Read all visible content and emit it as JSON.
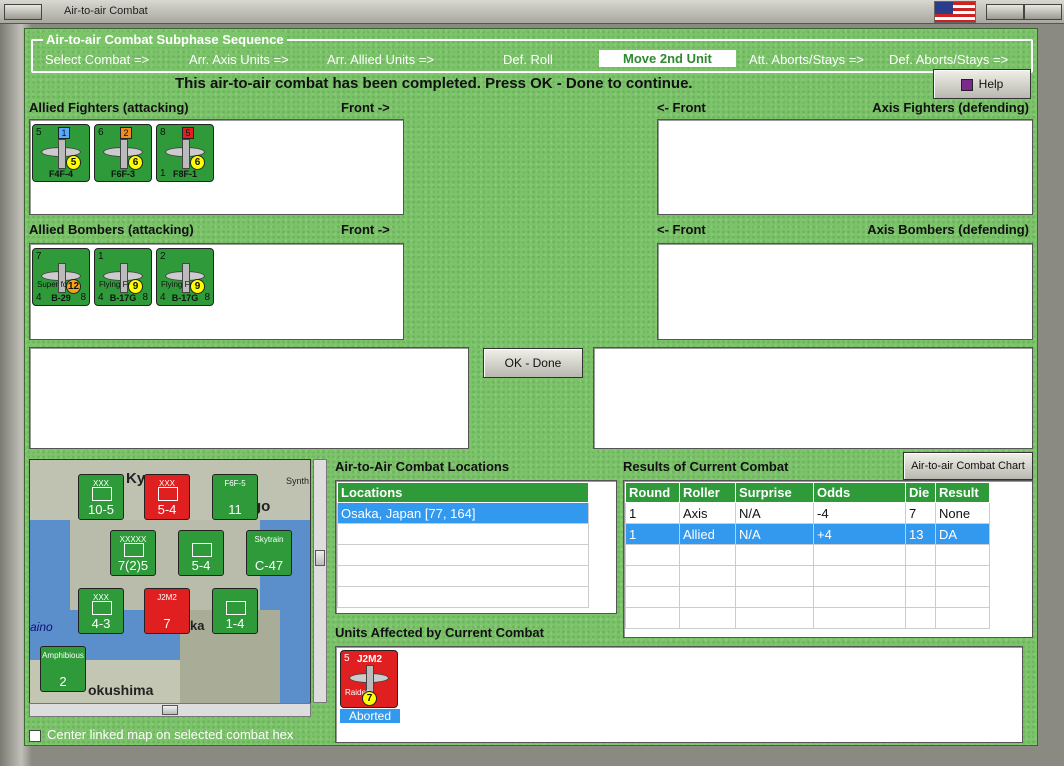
{
  "window": {
    "title": "Air-to-air Combat"
  },
  "sequence": {
    "legend": "Air-to-air Combat Subphase Sequence",
    "steps": [
      {
        "label": "Select Combat =>"
      },
      {
        "label": "Arr. Axis Units =>"
      },
      {
        "label": "Arr. Allied Units =>"
      },
      {
        "label": "Def. Roll"
      },
      {
        "label": "Move 2nd Unit"
      },
      {
        "label": "Att. Aborts/Stays =>"
      },
      {
        "label": "Def. Aborts/Stays =>"
      }
    ],
    "active_index": 4
  },
  "status_message": "This air-to-air combat has been completed.  Press OK - Done to continue.",
  "buttons": {
    "help": "Help",
    "ok_done": "OK - Done",
    "chart": "Air-to-air Combat Chart"
  },
  "allied_fighters": {
    "label": "Allied Fighters (attacking)",
    "front": "Front ->",
    "units": [
      {
        "name": "F4F-4",
        "tl": "5",
        "badge": "1",
        "badge_color": "#55aaff",
        "factor": "5",
        "bl": ""
      },
      {
        "name": "F6F-3",
        "tl": "6",
        "badge": "2",
        "badge_color": "#f08a24",
        "factor": "6",
        "bl": ""
      },
      {
        "name": "F8F-1",
        "tl": "8",
        "badge": "5",
        "badge_color": "#e02020",
        "factor": "6",
        "bl": "1"
      }
    ]
  },
  "axis_fighters": {
    "label": "Axis Fighters (defending)",
    "front": "<- Front"
  },
  "allied_bombers": {
    "label": "Allied Bombers (attacking)",
    "front": "Front ->",
    "units": [
      {
        "name": "B-29",
        "tl": "7",
        "sub": "Super fort",
        "factor": "12",
        "bl": "4",
        "br": "8"
      },
      {
        "name": "B-17G",
        "tl": "1",
        "sub": "Flying Fort",
        "factor": "9",
        "bl": "4",
        "br": "8"
      },
      {
        "name": "B-17G",
        "tl": "2",
        "sub": "Flying Fort",
        "factor": "9",
        "bl": "4",
        "br": "8"
      }
    ]
  },
  "axis_bombers": {
    "label": "Axis Bombers (defending)",
    "front": "<- Front"
  },
  "map": {
    "labels": [
      "Ky",
      "go",
      "Synth",
      "ka",
      "aino",
      "okushima"
    ],
    "units": [
      {
        "value": "10-5",
        "corps": "XXX",
        "stack": "2",
        "color": "#2e9a3a"
      },
      {
        "value": "5-4",
        "corps": "XXX",
        "stack": "",
        "color": "#e02020"
      },
      {
        "value": "11",
        "corps": "F6F-5",
        "stack": "6",
        "color": "#2e9a3a"
      },
      {
        "value": "7(2)5",
        "corps": "XXXXX",
        "stack": "2",
        "color": "#2e9a3a"
      },
      {
        "value": "5-4",
        "corps": "",
        "stack": "3",
        "color": "#2e9a3a"
      },
      {
        "value": "C-47",
        "corps": "Skytrain",
        "stack": "",
        "color": "#2e9a3a"
      },
      {
        "value": "4-3",
        "corps": "XXX",
        "stack": "",
        "color": "#2e9a3a"
      },
      {
        "value": "7",
        "corps": "J2M2",
        "stack": "22",
        "color": "#e02020"
      },
      {
        "value": "1-4",
        "corps": "",
        "stack": "2",
        "color": "#2e9a3a"
      },
      {
        "value": "2",
        "corps": "Amphibious",
        "stack": "3",
        "color": "#2e9a3a"
      }
    ],
    "center_checkbox_label": "Center linked map on selected combat hex"
  },
  "locations": {
    "title": "Air-to-Air Combat Locations",
    "header": "Locations",
    "rows": [
      "Osaka, Japan [77, 164]",
      "",
      "",
      "",
      ""
    ]
  },
  "results": {
    "title": "Results of Current Combat",
    "columns": [
      "Round",
      "Roller",
      "Surprise",
      "Odds",
      "Die",
      "Result"
    ],
    "rows": [
      [
        "1",
        "Axis",
        "N/A",
        "-4",
        "7",
        "None"
      ],
      [
        "1",
        "Allied",
        "N/A",
        "+4",
        "13",
        "DA"
      ],
      [
        "",
        "",
        "",
        "",
        "",
        ""
      ],
      [
        "",
        "",
        "",
        "",
        "",
        ""
      ],
      [
        "",
        "",
        "",
        "",
        "",
        ""
      ],
      [
        "",
        "",
        "",
        "",
        "",
        ""
      ]
    ],
    "selected_row": 1
  },
  "affected": {
    "title": "Units Affected by Current Combat",
    "units": [
      {
        "name": "J2M2",
        "sub": "Raiden",
        "factor": "7",
        "tl": "5",
        "status": "Aborted"
      }
    ]
  },
  "colors": {
    "felt": "#7cc46a",
    "allied": "#2e9a3a",
    "axis": "#e02020",
    "selected": "#3399ee"
  }
}
